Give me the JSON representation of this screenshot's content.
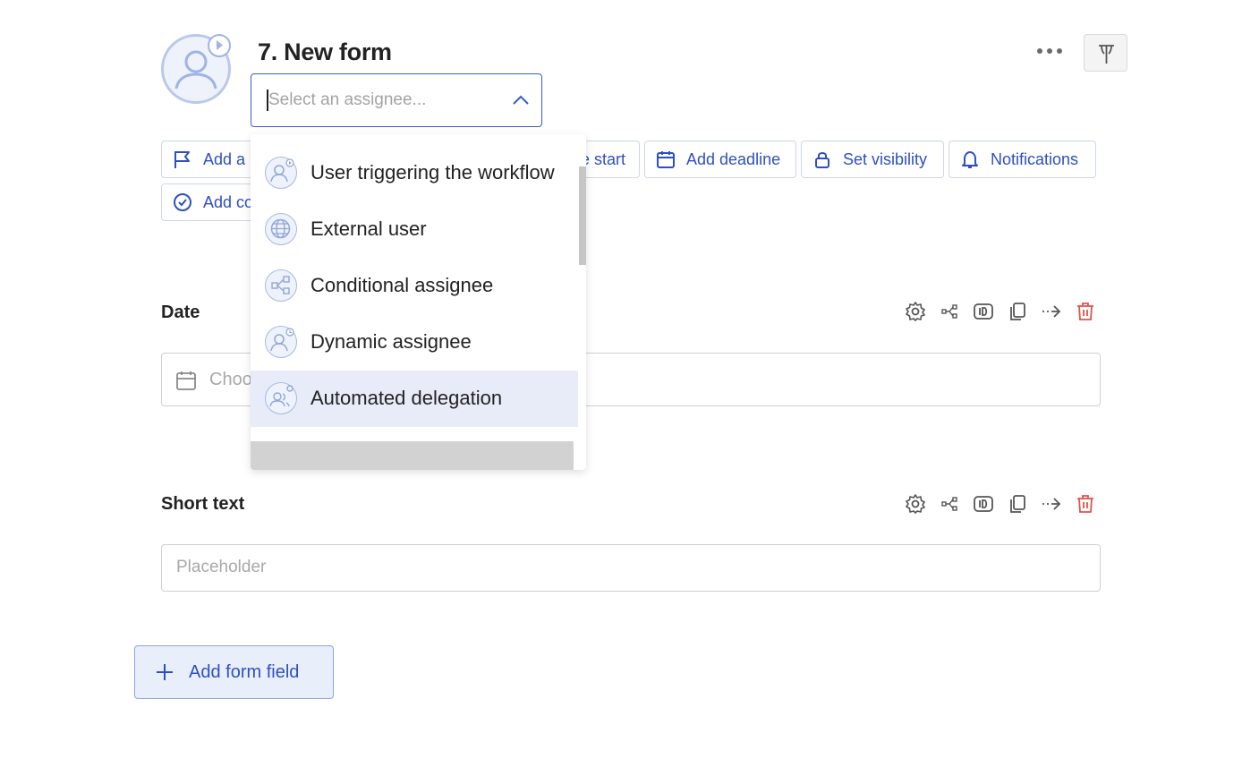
{
  "header": {
    "title": "7. New form",
    "assignee_placeholder": "Select an assignee..."
  },
  "chips": {
    "add_assignee": "Add a",
    "schedule_start": "e start",
    "add_deadline": "Add deadline",
    "set_visibility": "Set visibility",
    "notifications": "Notifications",
    "add_condition": "Add co"
  },
  "dropdown": {
    "options": [
      {
        "label": "User triggering the workflow",
        "icon": "user-play-icon"
      },
      {
        "label": "External user",
        "icon": "globe-icon"
      },
      {
        "label": "Conditional assignee",
        "icon": "branch-icon"
      },
      {
        "label": "Dynamic assignee",
        "icon": "user-dynamic-icon"
      },
      {
        "label": "Automated delegation",
        "icon": "users-gear-icon",
        "highlighted": true
      }
    ]
  },
  "fields": [
    {
      "label": "Date",
      "placeholder": "Choo"
    },
    {
      "label": "Short text",
      "placeholder": "Placeholder"
    }
  ],
  "add_field_label": "Add form field",
  "colors": {
    "accent": "#2e4fc2",
    "danger": "#e0524a",
    "highlight": "#e7ecf8"
  }
}
